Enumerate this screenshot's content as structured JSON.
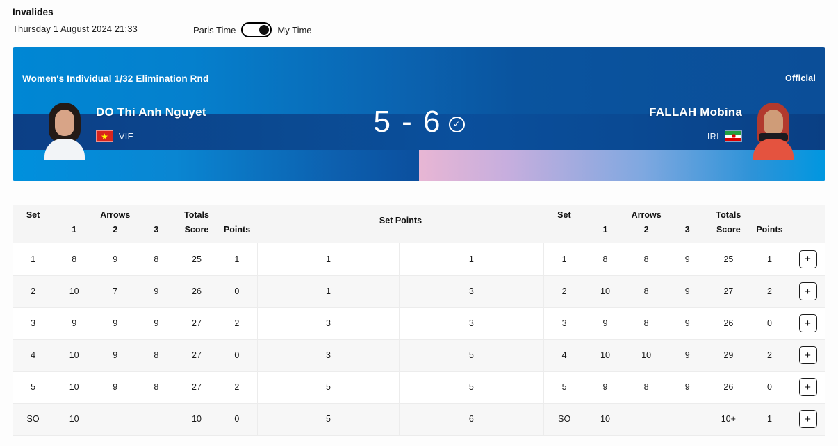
{
  "header": {
    "venue": "Invalides",
    "datetime": "Thursday 1 August 2024 21:33",
    "time_toggle": {
      "left_label": "Paris Time",
      "right_label": "My Time",
      "selected": "My Time"
    }
  },
  "match": {
    "phase": "Women's Individual 1/32 Elimination Rnd",
    "status": "Official",
    "score_display": "5 - 6",
    "winner_side": "right",
    "winner_icon": "check-circle-icon",
    "athlete_left": {
      "name": "DO Thi Anh Nguyet",
      "noc": "VIE",
      "flag_icon": "flag-vietnam-icon",
      "score": "5"
    },
    "athlete_right": {
      "name": "FALLAH Mobina",
      "noc": "IRI",
      "flag_icon": "flag-iran-icon",
      "score": "6"
    }
  },
  "table": {
    "headers": {
      "set": "Set",
      "arrows_group": "Arrows",
      "arrow_1": "1",
      "arrow_2": "2",
      "arrow_3": "3",
      "totals_group": "Totals",
      "score": "Score",
      "points": "Points",
      "set_points": "Set Points"
    },
    "rows": [
      {
        "left": {
          "set": "1",
          "a1": "8",
          "a2": "9",
          "a3": "8",
          "score": "25",
          "points": "1"
        },
        "setpoints": {
          "left": "1",
          "right": "1"
        },
        "right": {
          "set": "1",
          "a1": "8",
          "a2": "8",
          "a3": "9",
          "score": "25",
          "points": "1"
        },
        "expand": "+"
      },
      {
        "left": {
          "set": "2",
          "a1": "10",
          "a2": "7",
          "a3": "9",
          "score": "26",
          "points": "0"
        },
        "setpoints": {
          "left": "1",
          "right": "3"
        },
        "right": {
          "set": "2",
          "a1": "10",
          "a2": "8",
          "a3": "9",
          "score": "27",
          "points": "2"
        },
        "expand": "+"
      },
      {
        "left": {
          "set": "3",
          "a1": "9",
          "a2": "9",
          "a3": "9",
          "score": "27",
          "points": "2"
        },
        "setpoints": {
          "left": "3",
          "right": "3"
        },
        "right": {
          "set": "3",
          "a1": "9",
          "a2": "8",
          "a3": "9",
          "score": "26",
          "points": "0"
        },
        "expand": "+"
      },
      {
        "left": {
          "set": "4",
          "a1": "10",
          "a2": "9",
          "a3": "8",
          "score": "27",
          "points": "0"
        },
        "setpoints": {
          "left": "3",
          "right": "5"
        },
        "right": {
          "set": "4",
          "a1": "10",
          "a2": "10",
          "a3": "9",
          "score": "29",
          "points": "2"
        },
        "expand": "+"
      },
      {
        "left": {
          "set": "5",
          "a1": "10",
          "a2": "9",
          "a3": "8",
          "score": "27",
          "points": "2"
        },
        "setpoints": {
          "left": "5",
          "right": "5"
        },
        "right": {
          "set": "5",
          "a1": "9",
          "a2": "8",
          "a3": "9",
          "score": "26",
          "points": "0"
        },
        "expand": "+"
      },
      {
        "left": {
          "set": "SO",
          "a1": "10",
          "a2": "",
          "a3": "",
          "score": "10",
          "points": "0"
        },
        "setpoints": {
          "left": "5",
          "right": "6"
        },
        "right": {
          "set": "SO",
          "a1": "10",
          "a2": "",
          "a3": "",
          "score": "10+",
          "points": "1"
        },
        "expand": "+"
      }
    ]
  },
  "colors": {
    "banner_blue_light": "#0087d4",
    "banner_blue_dark": "#0b4e98",
    "inner_band": "#0a4a94",
    "strip_pink": "#e8b6d4",
    "page_bg": "#fdfdfd",
    "row_alt": "#f7f7f7",
    "header_bg": "#f5f5f5"
  }
}
